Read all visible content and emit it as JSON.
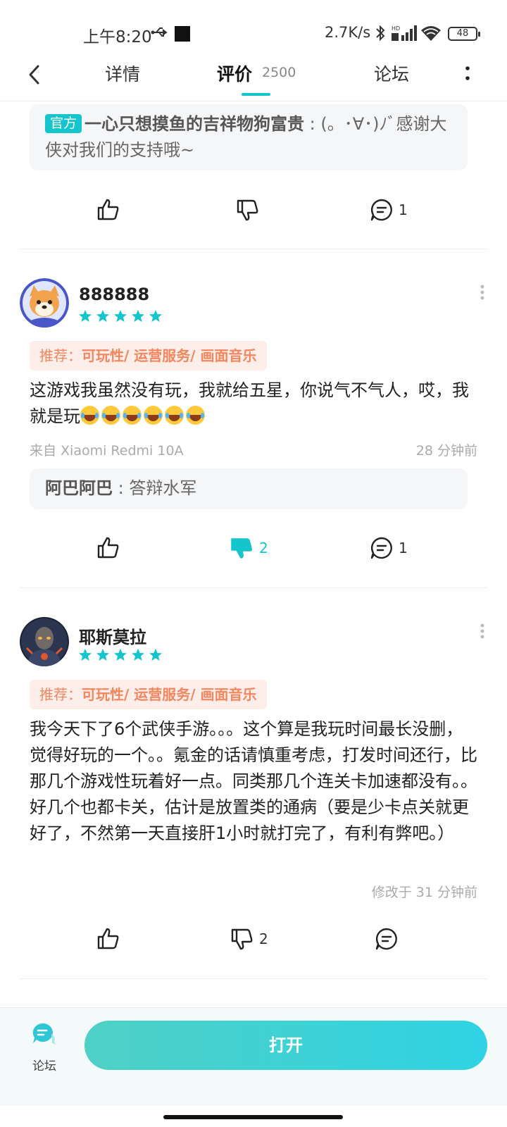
{
  "status_bar": {
    "time": "上午8:20",
    "network_speed": "2.7K/s",
    "battery": "48",
    "hd_label": "HD"
  },
  "nav": {
    "tabs": [
      {
        "label": "详情"
      },
      {
        "label": "评价",
        "count": "2500",
        "active": true
      },
      {
        "label": "论坛"
      }
    ]
  },
  "top_reply": {
    "badge": "官方",
    "author": "一心只想摸鱼的吉祥物狗富贵",
    "text": " : (。･∀･)ﾉﾞ感谢大侠对我们的支持哦~",
    "actions": {
      "reply_count": "1"
    }
  },
  "reviews": [
    {
      "username": "888888",
      "rating": 5,
      "tag_prefix": "推荐：",
      "tags": "可玩性/ 运营服务/ 画面音乐",
      "text": "这游戏我虽然没有玩，我就给五星，你说气不气人，哎，我就是玩",
      "emoji_count": 6,
      "device": "来自 Xiaomi Redmi 10A",
      "time": "28 分钟前",
      "reply": {
        "author": "阿巴阿巴",
        "text": " : 答辩水军"
      },
      "actions": {
        "dislike_count": "2",
        "reply_count": "1",
        "dislike_active": true
      }
    },
    {
      "username": "耶斯莫拉",
      "rating": 5,
      "tag_prefix": "推荐：",
      "tags": "可玩性/ 运营服务/ 画面音乐",
      "text": "我今天下了6个武侠手游。。。这个算是我玩时间最长没删，觉得好玩的一个。。氪金的话请慎重考虑，打发时间还行，比那几个游戏性玩着好一点。同类那几个连关卡加速都没有。。好几个也都卡关，估计是放置类的通病（要是少卡点关就更好了，不然第一天直接肝1小时就打完了，有利有弊吧。）",
      "time": "修改于 31 分钟前",
      "actions": {
        "dislike_count": "2"
      }
    }
  ],
  "bottom_bar": {
    "forum_label": "论坛",
    "open_label": "打开"
  },
  "colors": {
    "accent": "#15c5ce",
    "tag_text": "#f2865e",
    "tag_bg": "#fdeee9"
  }
}
